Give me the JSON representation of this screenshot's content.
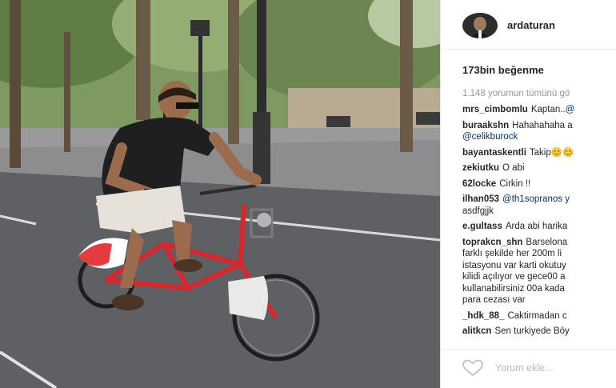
{
  "post": {
    "username": "ardaturan",
    "likes": "173bin beğenme",
    "view_all_comments": "1.148 yorumun tümünü gö"
  },
  "comments": [
    {
      "author": "mrs_cimbomlu",
      "text": "Kaptan..",
      "mention": "@",
      "extra": ""
    },
    {
      "author": "buraakshn",
      "text": "Hahahahaha a",
      "mention": "",
      "extra": "@celikburock"
    },
    {
      "author": "bayantaskentli",
      "text": "Takip😊😊",
      "mention": "",
      "extra": ""
    },
    {
      "author": "zekiutku",
      "text": "O abi",
      "mention": "",
      "extra": ""
    },
    {
      "author": "62locke",
      "text": "Cirkin !!",
      "mention": "",
      "extra": ""
    },
    {
      "author": "ilhan053",
      "text": "",
      "mention": "@th1sopranos y",
      "extra": "asdfgjjk"
    },
    {
      "author": "e.gultass",
      "text": "Arda abi harika",
      "mention": "",
      "extra": ""
    },
    {
      "author": "toprakcn_shn",
      "text": "Barselona",
      "mention": "",
      "extra": "farklı şekilde her 200m li\nistasyonu var karti okutuy\nkilidi açılıyor ve gece00 a\nkullanabilirsiniz 00a kada\npara cezası var"
    },
    {
      "author": "_hdk_88_",
      "text": "Caktirmadan c",
      "mention": "",
      "extra": ""
    },
    {
      "author": "alitkcn",
      "text": "Sen turkiyede Böy",
      "mention": "",
      "extra": ""
    }
  ],
  "comment_box": {
    "placeholder": "Yorum ekle..."
  },
  "icons": {
    "like": "heart-icon"
  },
  "colors": {
    "mention": "#003569",
    "muted": "#999999",
    "bike_red": "#d8262c"
  }
}
